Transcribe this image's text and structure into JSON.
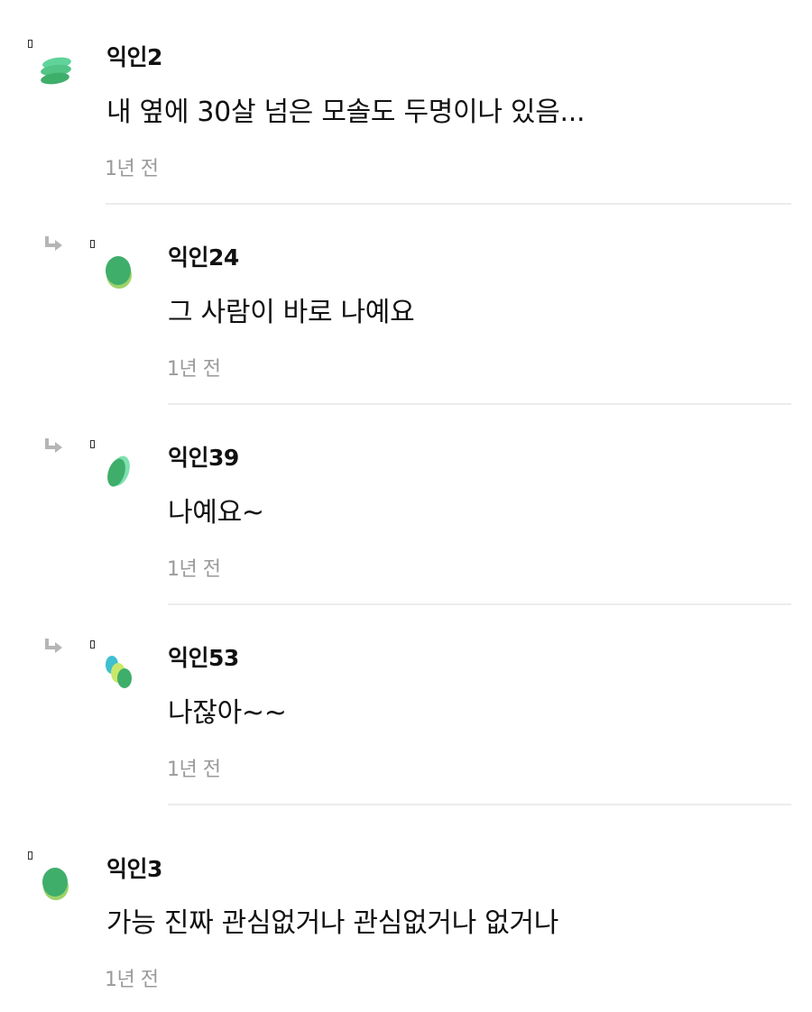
{
  "comments": [
    {
      "nickname": "익인2",
      "text": "내 옆에 30살 넘은 모솔도 두명이나 있음...",
      "time": "1년 전",
      "is_reply": false,
      "avatar_icon": "green-stacked-coins-icon"
    },
    {
      "nickname": "익인24",
      "text": "그 사람이 바로 나예요",
      "time": "1년 전",
      "is_reply": true,
      "avatar_icon": "green-leaf-icon"
    },
    {
      "nickname": "익인39",
      "text": "나예요~",
      "time": "1년 전",
      "is_reply": true,
      "avatar_icon": "green-leaf-icon"
    },
    {
      "nickname": "익인53",
      "text": "나잖아~~",
      "time": "1년 전",
      "is_reply": true,
      "avatar_icon": "multicolor-dots-icon"
    },
    {
      "nickname": "익인3",
      "text": "가능 진짜 관심없거나 관심없거나 없거나",
      "time": "1년 전",
      "is_reply": false,
      "avatar_icon": "green-leaf-icon"
    }
  ],
  "colors": {
    "reply_arrow": "#b5b5b5",
    "time_text": "#9a9a9a",
    "divider": "#ececec"
  }
}
